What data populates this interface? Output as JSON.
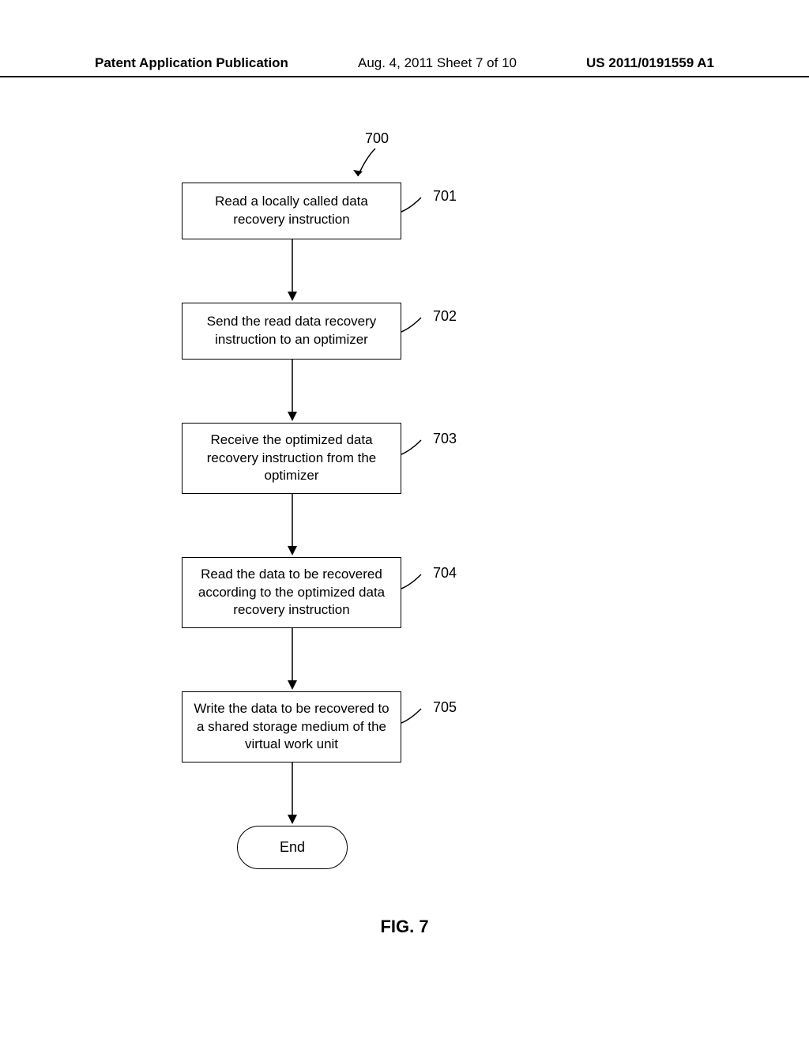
{
  "header": {
    "left": "Patent Application Publication",
    "center": "Aug. 4, 2011  Sheet 7 of 10",
    "right": "US 2011/0191559 A1"
  },
  "flowchart": {
    "start_number": "700",
    "steps": [
      {
        "number": "701",
        "text": "Read a locally called data recovery instruction"
      },
      {
        "number": "702",
        "text": "Send the read data recovery instruction to an optimizer"
      },
      {
        "number": "703",
        "text": "Receive the optimized data recovery instruction from the optimizer"
      },
      {
        "number": "704",
        "text": "Read the data to be recovered according to the optimized data recovery instruction"
      },
      {
        "number": "705",
        "text": "Write the data to be recovered to a shared storage medium of the virtual work unit"
      }
    ],
    "end_label": "End"
  },
  "figure_label": "FIG. 7"
}
